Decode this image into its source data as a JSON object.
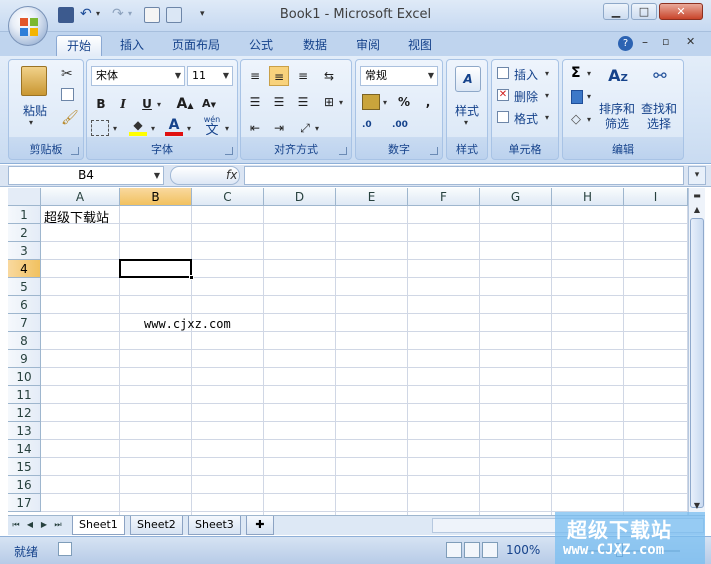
{
  "window": {
    "title": "Book1 - Microsoft Excel"
  },
  "quick_access": {
    "icons": [
      "save-icon",
      "undo-icon",
      "redo-icon",
      "print-preview-icon",
      "publish-icon",
      "customize-icon"
    ]
  },
  "tabs": [
    {
      "label": "开始",
      "active": true
    },
    {
      "label": "插入"
    },
    {
      "label": "页面布局"
    },
    {
      "label": "公式"
    },
    {
      "label": "数据"
    },
    {
      "label": "审阅"
    },
    {
      "label": "视图"
    }
  ],
  "ribbon": {
    "clipboard": {
      "label": "剪贴板",
      "paste": "粘贴"
    },
    "font": {
      "label": "字体",
      "name": "宋体",
      "size": "11",
      "wen_label": "wén",
      "wen_char": "文"
    },
    "alignment": {
      "label": "对齐方式"
    },
    "number": {
      "label": "数字",
      "format": "常规",
      "percent": "%",
      "comma": ",",
      "dec_inc": ".0",
      "dec_dec": ".00"
    },
    "styles": {
      "label": "样式",
      "button": "样式"
    },
    "cells": {
      "label": "单元格",
      "insert": "插入",
      "delete": "删除",
      "format": "格式"
    },
    "editing": {
      "label": "编辑",
      "sum": "Σ",
      "sort_line1": "排序和",
      "sort_line2": "筛选",
      "find_line1": "查找和",
      "find_line2": "选择"
    }
  },
  "formula_bar": {
    "name_box": "B4",
    "fx": "fx",
    "formula": ""
  },
  "grid": {
    "columns": [
      "A",
      "B",
      "C",
      "D",
      "E",
      "F",
      "G",
      "H",
      "I"
    ],
    "rows": [
      "1",
      "2",
      "3",
      "4",
      "5",
      "6",
      "7",
      "8",
      "9",
      "10",
      "11",
      "12",
      "13",
      "14",
      "15",
      "16",
      "17"
    ],
    "selected_column": "B",
    "selected_row": "4",
    "cells": {
      "A1": "超级下载站",
      "B7": "www.cjxz.com"
    }
  },
  "sheets": [
    {
      "label": "Sheet1",
      "active": true
    },
    {
      "label": "Sheet2"
    },
    {
      "label": "Sheet3"
    }
  ],
  "status": {
    "text": "就绪",
    "zoom": "100%"
  },
  "watermark": {
    "line1": "超级下载站",
    "line2": "www.CJXZ.com"
  }
}
